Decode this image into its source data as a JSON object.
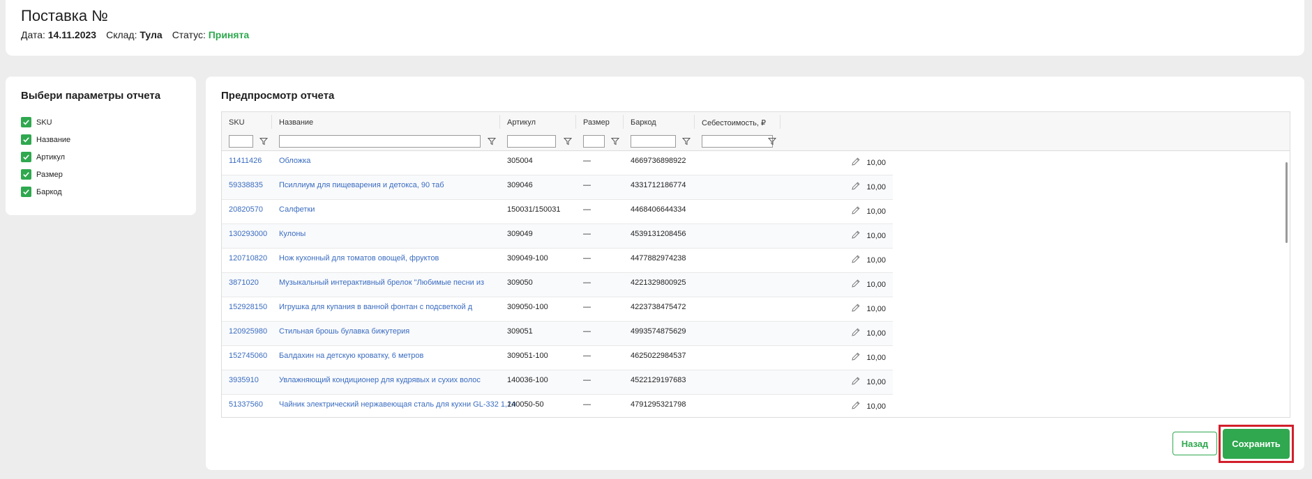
{
  "header": {
    "title": "Поставка №",
    "date_label": "Дата:",
    "date_value": "14.11.2023",
    "warehouse_label": "Склад:",
    "warehouse_value": "Тула",
    "status_label": "Статус:",
    "status_value": "Принята"
  },
  "params": {
    "title": "Выбери параметры отчета",
    "items": [
      {
        "label": "SKU",
        "checked": true
      },
      {
        "label": "Название",
        "checked": true
      },
      {
        "label": "Артикул",
        "checked": true
      },
      {
        "label": "Размер",
        "checked": true
      },
      {
        "label": "Баркод",
        "checked": true
      }
    ]
  },
  "preview": {
    "title": "Предпросмотр отчета",
    "columns": [
      "SKU",
      "Название",
      "Артикул",
      "Размер",
      "Баркод",
      "Себестоимость, ₽"
    ],
    "rows": [
      {
        "sku": "11411426",
        "name": "Обложка",
        "article": "305004",
        "size": "—",
        "barcode": "4669736898922",
        "cost": "10,00"
      },
      {
        "sku": "59338835",
        "name": "Псиллиум для пищеварения и детокса, 90 таб",
        "article": "309046",
        "size": "—",
        "barcode": "4331712186774",
        "cost": "10,00"
      },
      {
        "sku": "20820570",
        "name": "Салфетки",
        "article": "150031/150031",
        "size": "—",
        "barcode": "4468406644334",
        "cost": "10,00"
      },
      {
        "sku": "130293000",
        "name": "Кулоны",
        "article": "309049",
        "size": "—",
        "barcode": "4539131208456",
        "cost": "10,00"
      },
      {
        "sku": "120710820",
        "name": "Нож кухонный для томатов овощей, фруктов",
        "article": "309049-100",
        "size": "—",
        "barcode": "4477882974238",
        "cost": "10,00"
      },
      {
        "sku": "3871020",
        "name": "Музыкальный интерактивный брелок \"Любимые песни из",
        "article": "309050",
        "size": "—",
        "barcode": "4221329800925",
        "cost": "10,00"
      },
      {
        "sku": "152928150",
        "name": "Игрушка для купания в ванной фонтан с подсветкой д",
        "article": "309050-100",
        "size": "—",
        "barcode": "4223738475472",
        "cost": "10,00"
      },
      {
        "sku": "120925980",
        "name": "Стильная брошь булавка бижутерия",
        "article": "309051",
        "size": "—",
        "barcode": "4993574875629",
        "cost": "10,00"
      },
      {
        "sku": "152745060",
        "name": "Балдахин на детскую кроватку, 6 метров",
        "article": "309051-100",
        "size": "—",
        "barcode": "4625022984537",
        "cost": "10,00"
      },
      {
        "sku": "3935910",
        "name": "Увлажняющий кондиционер для кудрявых и сухих волос",
        "article": "140036-100",
        "size": "—",
        "barcode": "4522129197683",
        "cost": "10,00"
      },
      {
        "sku": "51337560",
        "name": "Чайник электрический нержавеющая сталь для кухни GL-332 1,2л",
        "article": "140050-50",
        "size": "—",
        "barcode": "4791295321798",
        "cost": "10,00"
      }
    ]
  },
  "actions": {
    "back_label": "Назад",
    "save_label": "Сохранить"
  },
  "colors": {
    "accent": "#2fa84f",
    "link": "#3a6cc0",
    "highlight": "#d21f2b"
  },
  "icons": {
    "checkbox": "check-icon",
    "filter": "filter-icon",
    "edit": "pencil-icon"
  }
}
